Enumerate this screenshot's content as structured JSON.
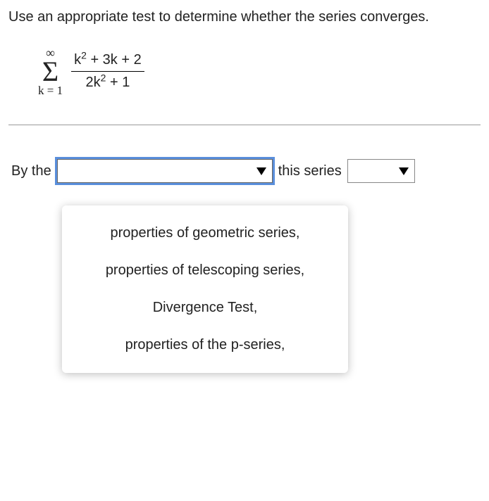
{
  "question": "Use an appropriate test to determine whether the series converges.",
  "formula": {
    "sigma_top": "∞",
    "sigma_bottom": "k = 1",
    "numerator_parts": {
      "k": "k",
      "exp1": "2",
      "rest": " + 3k + 2"
    },
    "denominator_parts": {
      "coef": "2k",
      "exp2": "2",
      "rest2": " + 1"
    }
  },
  "answer": {
    "prefix": "By the",
    "middle": "this series"
  },
  "dropdown_options": [
    "properties of geometric series,",
    "properties of telescoping series,",
    "Divergence Test,",
    "properties of the p-series,"
  ]
}
